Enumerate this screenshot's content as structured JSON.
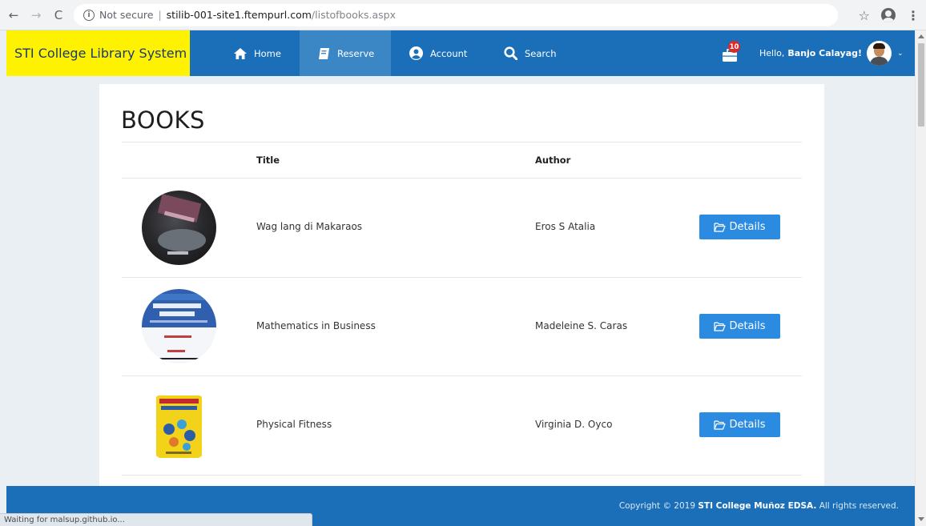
{
  "browser": {
    "security_label": "Not secure",
    "host": "stilib-001-site1.ftempurl.com",
    "path": "/listofbooks.aspx",
    "status_text": "Waiting for malsup.github.io..."
  },
  "navbar": {
    "brand": "STI College Library System",
    "items": [
      {
        "label": "Home",
        "icon": "home-icon"
      },
      {
        "label": "Reserve",
        "icon": "book-icon"
      },
      {
        "label": "Account",
        "icon": "account-icon"
      },
      {
        "label": "Search",
        "icon": "search-icon"
      }
    ],
    "notification_count": "10",
    "greeting_prefix": "Hello,",
    "user_name": "Banjo Calayag!",
    "active_color": "#3b87c6",
    "bar_color": "#1a6fb8",
    "brand_color": "#fff200"
  },
  "page": {
    "title": "BOOKS",
    "columns": {
      "title": "Title",
      "author": "Author"
    },
    "details_label": "Details",
    "books": [
      {
        "title": "Wag lang di Makaraos",
        "author": "Eros S Atalia",
        "cover": "dark-book-cover"
      },
      {
        "title": "Mathematics in Business",
        "author": "Madeleine S. Caras",
        "cover": "blue-book-cover"
      },
      {
        "title": "Physical Fitness",
        "author": "Virginia D. Oyco",
        "cover": "yellow-book-cover"
      }
    ],
    "button_color": "#2b8be0"
  },
  "footer": {
    "prefix": "Copyright © 2019",
    "org": "STI College Muñoz EDSA.",
    "suffix": "All rights reserved."
  }
}
